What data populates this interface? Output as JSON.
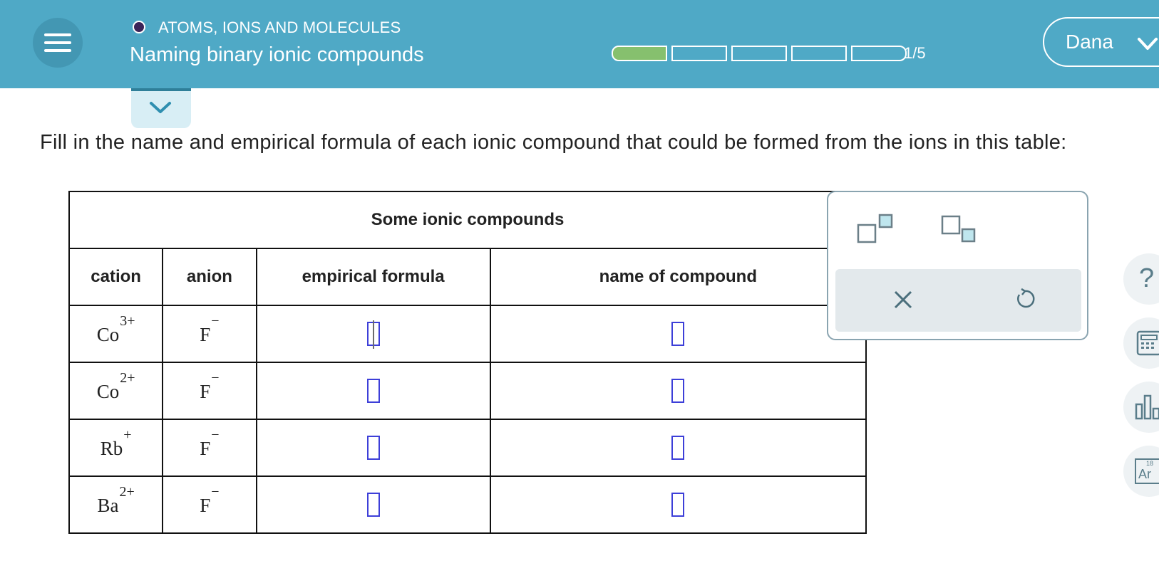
{
  "header": {
    "topic": "ATOMS, IONS AND MOLECULES",
    "title": "Naming binary ionic compounds",
    "progress_text": "1/5",
    "progress": {
      "completed": 1,
      "total": 5
    },
    "user_name": "Dana",
    "colors": {
      "bar": "#4fa9c6",
      "progress_done": "#86c06e"
    }
  },
  "question": "Fill in the name and empirical formula of each ionic compound that could be formed from the ions in this table:",
  "table": {
    "caption": "Some ionic compounds",
    "headers": [
      "cation",
      "anion",
      "empirical formula",
      "name of compound"
    ],
    "rows": [
      {
        "cation": "Co",
        "cation_charge": "3+",
        "anion": "F",
        "anion_charge": "−"
      },
      {
        "cation": "Co",
        "cation_charge": "2+",
        "anion": "F",
        "anion_charge": "−"
      },
      {
        "cation": "Rb",
        "cation_charge": "+",
        "anion": "F",
        "anion_charge": "−"
      },
      {
        "cation": "Ba",
        "cation_charge": "2+",
        "anion": "F",
        "anion_charge": "−"
      }
    ]
  },
  "tool_panel": {
    "icons": [
      "superscript-icon",
      "subscript-icon",
      "clear-icon",
      "undo-icon"
    ]
  },
  "side_tools": {
    "help": "?",
    "periodic_number": "18",
    "periodic_symbol": "Ar"
  }
}
